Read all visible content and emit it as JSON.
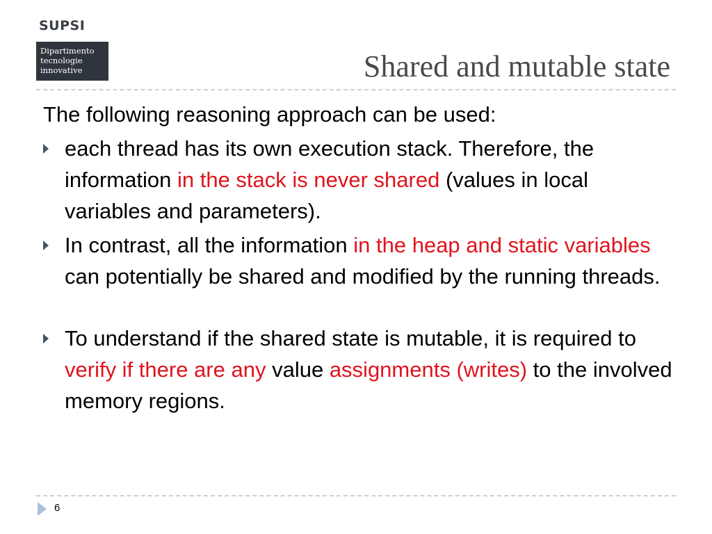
{
  "logo": {
    "wordmark": "SUPSI",
    "box_lines": [
      "Dipartimento",
      "tecnologie",
      "innovative"
    ]
  },
  "slide": {
    "title": "Shared and mutable state",
    "intro": "The following reasoning approach can be used:",
    "bullets": [
      {
        "parts": [
          "each thread has its own execution stack. Therefore, the information ",
          "in the stack is never shared",
          " (values in local variables and parameters)."
        ]
      },
      {
        "parts": [
          "In contrast, all the information ",
          "in the heap and static variables",
          " can potentially be shared and modified by the running threads."
        ]
      },
      {
        "parts": [
          "To understand if the shared state is mutable, it is required to ",
          "verify if there are any",
          " value ",
          "assignments (writes)",
          " to the involved memory regions."
        ]
      }
    ],
    "page_number": "6"
  },
  "colors": {
    "highlight": "#e0141e",
    "bullet_arrow": "#4a5560",
    "footer_arrow": "#a9c1d8",
    "rule": "#c6d0da",
    "logo_box": "#2f353d"
  },
  "icons": {
    "bullet": "triangle-right-icon",
    "footer": "triangle-right-icon"
  }
}
